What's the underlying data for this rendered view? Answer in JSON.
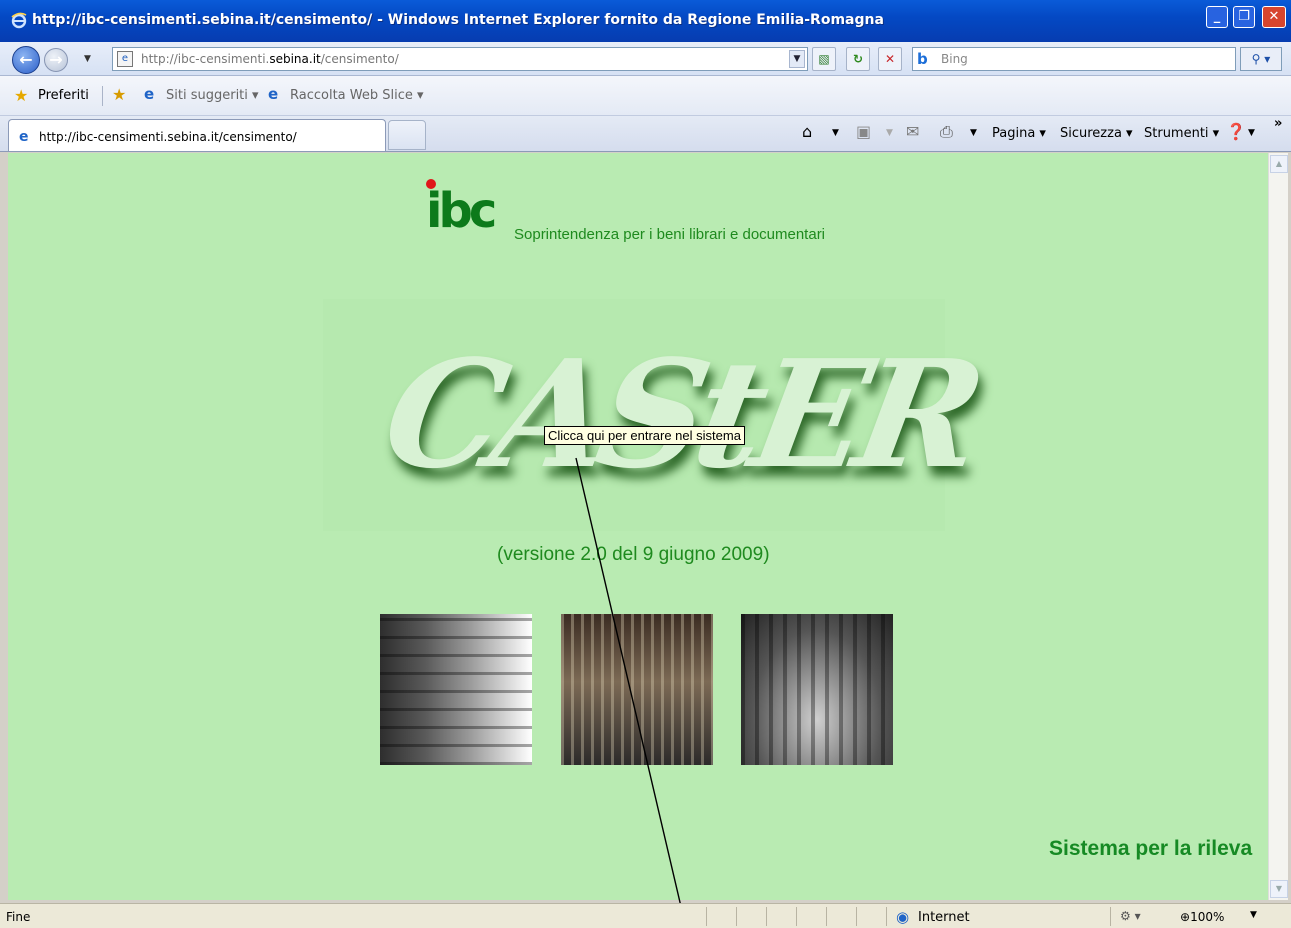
{
  "window": {
    "title": "http://ibc-censimenti.sebina.it/censimento/ - Windows Internet Explorer fornito da Regione Emilia-Romagna"
  },
  "address": {
    "prefix": "http://ibc-censimenti.",
    "domain": "sebina.it",
    "suffix": "/censimento/"
  },
  "search": {
    "placeholder": "Bing"
  },
  "favorites": {
    "preferiti": "Preferiti",
    "siti": "Siti suggeriti ▾",
    "raccolta": "Raccolta Web Slice ▾"
  },
  "tab": {
    "label": "http://ibc-censimenti.sebina.it/censimento/"
  },
  "commands": {
    "pagina": "Pagina ▾",
    "sicurezza": "Sicurezza ▾",
    "strumenti": "Strumenti ▾"
  },
  "page": {
    "logo": "ibc",
    "subtitle": "Soprintendenza per i beni librari e documentari",
    "casier": "CAStER",
    "tooltip": "Clicca qui per entrare nel sistema",
    "version": "(versione 2.0 del 9 giugno 2009)",
    "sistema": "Sistema per la rileva"
  },
  "status": {
    "text": "Fine",
    "zone": "Internet",
    "zoom": "100%"
  },
  "colors": {
    "page_bg": "#b9ebb2",
    "accent_green": "#1e8a1e",
    "titlebar_blue": "#0449c4"
  }
}
